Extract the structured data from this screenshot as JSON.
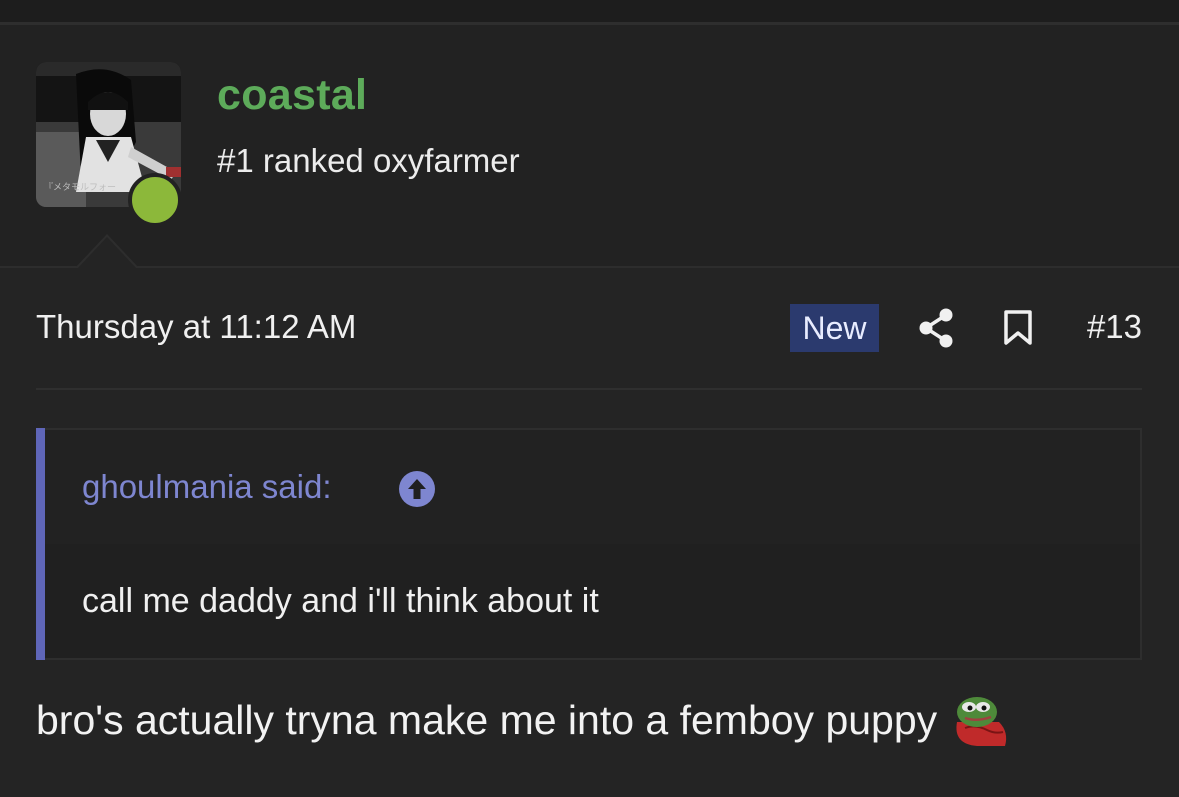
{
  "user": {
    "username": "coastal",
    "title": "#1 ranked oxyfarmer",
    "avatar_caption": "『メタモルフォー",
    "status": "online"
  },
  "post": {
    "timestamp": "Thursday at 11:12 AM",
    "badge": "New",
    "number": "#13",
    "body": "bro's actually tryna make me into a femboy puppy",
    "emoji": "pepe-emoji"
  },
  "quote": {
    "author": "ghoulmania said:",
    "text": "call me daddy and i'll think about it"
  },
  "colors": {
    "username": "#5dab5a",
    "badge_bg": "#2b3a6e",
    "quote_accent": "#5f66b8",
    "status_online": "#8cb83a"
  },
  "icons": [
    "share-icon",
    "bookmark-icon",
    "arrow-up-circle-icon"
  ]
}
